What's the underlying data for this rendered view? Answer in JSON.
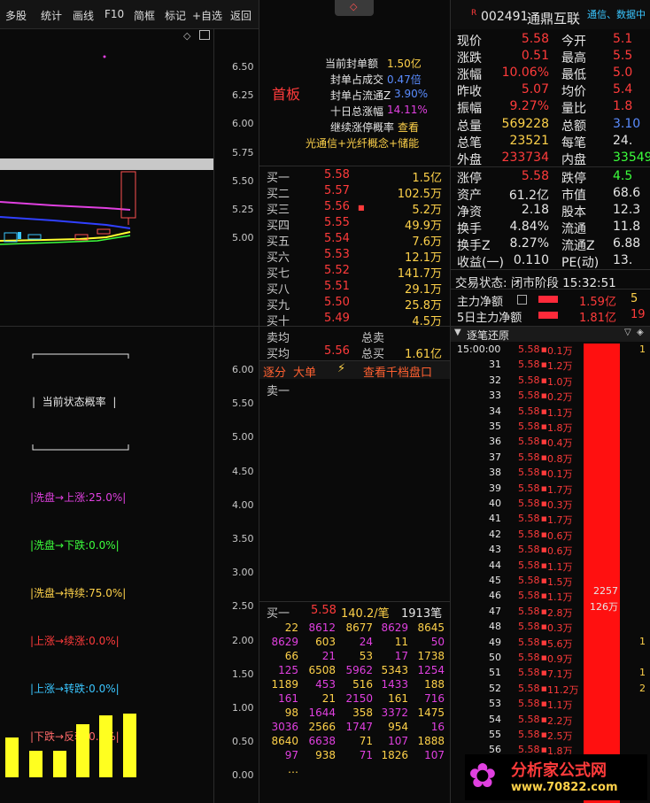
{
  "toolbar": {
    "items": [
      "多股",
      "统计",
      "画线",
      "F10",
      "简框",
      "标记",
      "+自选",
      "返回"
    ]
  },
  "left_chart": {
    "axis": [
      "6.50",
      "6.25",
      "6.00",
      "5.75",
      "5.50",
      "5.25",
      "5.00"
    ]
  },
  "info_panel": {
    "title": "首板",
    "rows": [
      {
        "label": "当前封单额",
        "value": "1.50亿"
      },
      {
        "label": "封单占成交",
        "value": "0.47倍"
      },
      {
        "label": "封单占流通Z",
        "value": "3.90%"
      },
      {
        "label": "十日总涨幅",
        "value": "14.11%"
      },
      {
        "label": "继续涨停概率",
        "value": "查看"
      }
    ],
    "concepts": "光通信+光纤概念+储能"
  },
  "header": {
    "badge": "R",
    "code": "002491",
    "name": "通鼎互联",
    "tags": "通信、数据中"
  },
  "quote": {
    "rows": [
      {
        "l": "现价",
        "v": "5.58",
        "l2": "今开",
        "v2": "5.1"
      },
      {
        "l": "涨跌",
        "v": "0.51",
        "l2": "最高",
        "v2": "5.5"
      },
      {
        "l": "涨幅",
        "v": "10.06%",
        "l2": "最低",
        "v2": "5.0"
      },
      {
        "l": "昨收",
        "v": "5.07",
        "l2": "均价",
        "v2": "5.4"
      },
      {
        "l": "振幅",
        "v": "9.27%",
        "l2": "量比",
        "v2": "1.8"
      },
      {
        "l": "总量",
        "v": "569228",
        "l2": "总额",
        "v2": "3.10"
      },
      {
        "l": "总笔",
        "v": "23521",
        "l2": "每笔",
        "v2": "24."
      },
      {
        "l": "外盘",
        "v": "233734",
        "l2": "内盘",
        "v2": "33549"
      },
      {
        "l": "涨停",
        "v": "5.58",
        "l2": "跌停",
        "v2": "4.5"
      },
      {
        "l": "资产",
        "v": "61.2亿",
        "l2": "市值",
        "v2": "68.6"
      },
      {
        "l": "净资",
        "v": "2.18",
        "l2": "股本",
        "v2": "12.3"
      },
      {
        "l": "换手",
        "v": "4.84%",
        "l2": "流通",
        "v2": "11.8"
      },
      {
        "l": "换手Z",
        "v": "8.27%",
        "l2": "流通Z",
        "v2": "6.88"
      },
      {
        "l": "收益(一)",
        "v": "0.110",
        "l2": "PE(动)",
        "v2": "13."
      }
    ],
    "status": "交易状态: 闭市阶段 15:32:51",
    "main_flow_label": "主力净额",
    "main_flow_value": "1.59亿",
    "main_flow_value2": "5",
    "flow5_label": "5日主力净额",
    "flow5_value": "1.81亿",
    "flow5_value2": "19"
  },
  "orderbook": {
    "bids": [
      {
        "l": "买一",
        "p": "5.58",
        "v": "1.5亿"
      },
      {
        "l": "买二",
        "p": "5.57",
        "v": "102.5万"
      },
      {
        "l": "买三",
        "p": "5.56",
        "v": "5.2万"
      },
      {
        "l": "买四",
        "p": "5.55",
        "v": "49.9万"
      },
      {
        "l": "买五",
        "p": "5.54",
        "v": "7.6万"
      },
      {
        "l": "买六",
        "p": "5.53",
        "v": "12.1万"
      },
      {
        "l": "买七",
        "p": "5.52",
        "v": "141.7万"
      },
      {
        "l": "买八",
        "p": "5.51",
        "v": "29.1万"
      },
      {
        "l": "买九",
        "p": "5.50",
        "v": "25.8万"
      },
      {
        "l": "买十",
        "p": "5.49",
        "v": "4.5万"
      }
    ],
    "sell_avg_label": "卖均",
    "total_sell_label": "总卖",
    "buy_avg_label": "买均",
    "buy_avg": "5.56",
    "total_buy_label": "总买",
    "total_buy": "1.61亿",
    "tab1": "逐分",
    "tab2": "大单",
    "tab3": "查看千档盘口",
    "sell_one": "卖一"
  },
  "prob_panel": {
    "title": "当前状态概率",
    "axis": [
      "6.00",
      "5.50",
      "5.00",
      "4.50",
      "4.00",
      "3.50",
      "3.00",
      "2.50",
      "2.00",
      "1.50",
      "1.00",
      "0.50",
      "0.00"
    ],
    "lines": [
      {
        "text": "|洗盘→上涨:25.0%|",
        "color": "#e040e0"
      },
      {
        "text": "|洗盘→下跌:0.0%|",
        "color": "#3cff3c"
      },
      {
        "text": "|洗盘→持续:75.0%|",
        "color": "#ffd24a"
      },
      {
        "text": "|上涨→续涨:0.0%|",
        "color": "#ff3b3b"
      },
      {
        "text": "|上涨→转跌:0.0%|",
        "color": "#3ac6ff"
      },
      {
        "text": "|下跌→反转:0.0%|",
        "color": "#ff6a6a"
      }
    ],
    "bars": [
      0.45,
      0.3,
      0.3,
      0.6,
      0.7,
      0.72
    ]
  },
  "queue": {
    "label": "买一",
    "price": "5.58",
    "avg": "140.2/笔",
    "count": "1913笔",
    "rows": [
      [
        "22",
        "8612",
        "8677",
        "8629",
        "8645"
      ],
      [
        "8629",
        "603",
        "24",
        "11",
        "50"
      ],
      [
        "66",
        "21",
        "53",
        "17",
        "1738"
      ],
      [
        "125",
        "6508",
        "5962",
        "5343",
        "1254"
      ],
      [
        "1189",
        "453",
        "516",
        "1433",
        "188"
      ],
      [
        "161",
        "21",
        "2150",
        "161",
        "716"
      ],
      [
        "98",
        "1644",
        "358",
        "3372",
        "1475"
      ],
      [
        "3036",
        "2566",
        "1747",
        "954",
        "16"
      ],
      [
        "8640",
        "6638",
        "71",
        "107",
        "1888"
      ],
      [
        "97",
        "938",
        "71",
        "1826",
        "107"
      ],
      [
        "…",
        "",
        "",
        "",
        ""
      ]
    ]
  },
  "ticks": {
    "title": "逐笔还原",
    "rows": [
      {
        "t": "15:00:00",
        "p": "5.58",
        "v": "0.1万"
      },
      {
        "t": "31",
        "p": "5.58",
        "v": "1.2万"
      },
      {
        "t": "32",
        "p": "5.58",
        "v": "1.0万"
      },
      {
        "t": "33",
        "p": "5.58",
        "v": "0.2万"
      },
      {
        "t": "34",
        "p": "5.58",
        "v": "1.1万"
      },
      {
        "t": "35",
        "p": "5.58",
        "v": "1.8万"
      },
      {
        "t": "36",
        "p": "5.58",
        "v": "0.4万"
      },
      {
        "t": "37",
        "p": "5.58",
        "v": "0.8万"
      },
      {
        "t": "38",
        "p": "5.58",
        "v": "0.1万"
      },
      {
        "t": "39",
        "p": "5.58",
        "v": "1.7万"
      },
      {
        "t": "40",
        "p": "5.58",
        "v": "0.3万"
      },
      {
        "t": "41",
        "p": "5.58",
        "v": "1.7万"
      },
      {
        "t": "42",
        "p": "5.58",
        "v": "0.6万"
      },
      {
        "t": "43",
        "p": "5.58",
        "v": "0.6万"
      },
      {
        "t": "44",
        "p": "5.58",
        "v": "1.1万"
      },
      {
        "t": "45",
        "p": "5.58",
        "v": "1.5万"
      },
      {
        "t": "46",
        "p": "5.58",
        "v": "1.1万"
      },
      {
        "t": "47",
        "p": "5.58",
        "v": "2.8万"
      },
      {
        "t": "48",
        "p": "5.58",
        "v": "0.3万"
      },
      {
        "t": "49",
        "p": "5.58",
        "v": "5.6万"
      },
      {
        "t": "50",
        "p": "5.58",
        "v": "0.9万"
      },
      {
        "t": "51",
        "p": "5.58",
        "v": "7.1万"
      },
      {
        "t": "52",
        "p": "5.58",
        "v": "11.2万"
      },
      {
        "t": "53",
        "p": "5.58",
        "v": "1.1万"
      },
      {
        "t": "54",
        "p": "5.58",
        "v": "2.2万"
      },
      {
        "t": "55",
        "p": "5.58",
        "v": "2.5万"
      },
      {
        "t": "56",
        "p": "5.58",
        "v": "1.8万"
      },
      {
        "t": "57",
        "p": "5.58",
        "v": "1.0万"
      },
      {
        "t": "58",
        "p": "5.58",
        "v": "1.5万"
      }
    ],
    "bar_label1": "2257",
    "bar_label2": "126万",
    "side": [
      "1",
      "",
      "",
      "",
      "",
      "",
      "",
      "",
      "",
      "",
      "",
      "",
      "",
      "",
      "",
      "",
      "",
      "",
      "",
      "1",
      "",
      "1",
      "2"
    ]
  },
  "watermark": {
    "brand": "分析家公式网",
    "url": "www.70822.com"
  }
}
